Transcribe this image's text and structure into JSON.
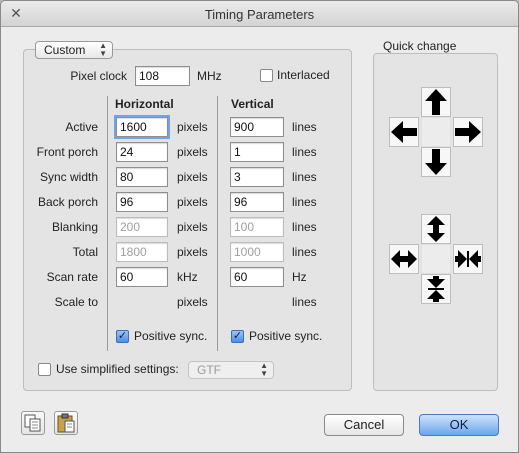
{
  "window": {
    "title": "Timing Parameters"
  },
  "preset": {
    "selected": "Custom"
  },
  "pixel_clock": {
    "label": "Pixel clock",
    "value": "108",
    "unit": "MHz"
  },
  "interlaced": {
    "label": "Interlaced",
    "checked": false
  },
  "headers": {
    "horizontal": "Horizontal",
    "vertical": "Vertical"
  },
  "rows": [
    {
      "label": "Active",
      "h": "1600",
      "h_unit": "pixels",
      "v": "900",
      "v_unit": "lines"
    },
    {
      "label": "Front porch",
      "h": "24",
      "h_unit": "pixels",
      "v": "1",
      "v_unit": "lines"
    },
    {
      "label": "Sync width",
      "h": "80",
      "h_unit": "pixels",
      "v": "3",
      "v_unit": "lines"
    },
    {
      "label": "Back porch",
      "h": "96",
      "h_unit": "pixels",
      "v": "96",
      "v_unit": "lines"
    },
    {
      "label": "Blanking",
      "h": "200",
      "h_unit": "pixels",
      "v": "100",
      "v_unit": "lines"
    },
    {
      "label": "Total",
      "h": "1800",
      "h_unit": "pixels",
      "v": "1000",
      "v_unit": "lines"
    },
    {
      "label": "Scan rate",
      "h": "60",
      "h_unit": "kHz",
      "v": "60",
      "v_unit": "Hz"
    },
    {
      "label": "Scale to",
      "h": "",
      "h_unit": "pixels",
      "v": "",
      "v_unit": "lines"
    }
  ],
  "positive_sync": {
    "h_label": "Positive sync.",
    "v_label": "Positive sync.",
    "h_checked": true,
    "v_checked": true
  },
  "simplified": {
    "label": "Use simplified settings:",
    "checked": false,
    "option": "GTF"
  },
  "quick_change": {
    "title": "Quick change"
  },
  "buttons": {
    "cancel": "Cancel",
    "ok": "OK"
  },
  "glyphs": {
    "close": "✕",
    "check": "✓",
    "popup_arrows": "▲▼"
  },
  "icons": {
    "copy": "copy-icon",
    "paste": "paste-icon"
  }
}
